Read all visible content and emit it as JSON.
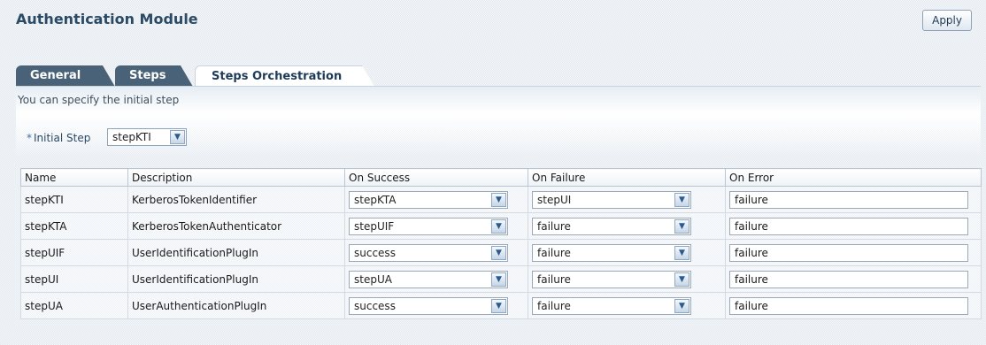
{
  "header": {
    "title": "Authentication Module",
    "apply_label": "Apply"
  },
  "tabs": [
    {
      "label": "General",
      "active": false
    },
    {
      "label": "Steps",
      "active": false
    },
    {
      "label": "Steps Orchestration",
      "active": true
    }
  ],
  "hint": "You can specify the initial step",
  "initial_step": {
    "required_marker": "*",
    "label": "Initial Step",
    "value": "stepKTI",
    "icon": "chevron-down-icon"
  },
  "table": {
    "columns": [
      "Name",
      "Description",
      "On Success",
      "On Failure",
      "On Error"
    ],
    "rows": [
      {
        "name": "stepKTI",
        "description": "KerberosTokenIdentifier",
        "on_success": "stepKTA",
        "on_failure": "stepUI",
        "on_error": "failure"
      },
      {
        "name": "stepKTA",
        "description": "KerberosTokenAuthenticator",
        "on_success": "stepUIF",
        "on_failure": "failure",
        "on_error": "failure"
      },
      {
        "name": "stepUIF",
        "description": "UserIdentificationPlugIn",
        "on_success": "success",
        "on_failure": "failure",
        "on_error": "failure"
      },
      {
        "name": "stepUI",
        "description": "UserIdentificationPlugIn",
        "on_success": "stepUA",
        "on_failure": "failure",
        "on_error": "failure"
      },
      {
        "name": "stepUA",
        "description": "UserAuthenticationPlugIn",
        "on_success": "success",
        "on_failure": "failure",
        "on_error": "failure"
      }
    ]
  },
  "colors": {
    "title": "#2b4a66",
    "tab_dark": "#4a6277",
    "border": "#8fa3b8"
  }
}
